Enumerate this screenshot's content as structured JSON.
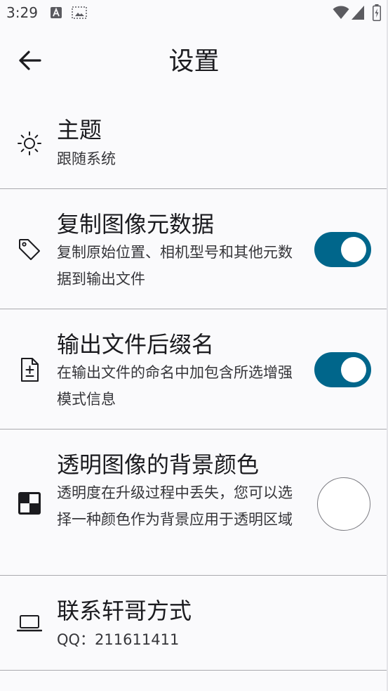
{
  "status_bar": {
    "time": "3:29",
    "icons": [
      "text-a-icon",
      "screenshot-icon",
      "wifi-icon",
      "signal-icon",
      "battery-icon"
    ]
  },
  "app_bar": {
    "title": "设置",
    "back_icon": "arrow-left-icon"
  },
  "settings": {
    "theme": {
      "icon": "sun-icon",
      "title": "主题",
      "subtitle": "跟随系统"
    },
    "copy_metadata": {
      "icon": "tag-icon",
      "title": "复制图像元数据",
      "subtitle": "复制原始位置、相机型号和其他元数据到输出文件",
      "enabled": true
    },
    "file_suffix": {
      "icon": "file-diff-icon",
      "title": "输出文件后缀名",
      "subtitle": "在输出文件的命名中加包含所选增强模式信息",
      "enabled": true
    },
    "background_color": {
      "icon": "checkerboard-icon",
      "title": "透明图像的背景颜色",
      "subtitle": "透明度在升级过程中丢失，您可以选择一种颜色作为背景应用于透明区域",
      "color": "#ffffff"
    },
    "contact": {
      "icon": "laptop-icon",
      "title": "联系轩哥方式",
      "subtitle": "QQ：211611411"
    }
  },
  "colors": {
    "accent": "#00668b",
    "background": "#fafafc",
    "divider": "#a9a9ae"
  }
}
